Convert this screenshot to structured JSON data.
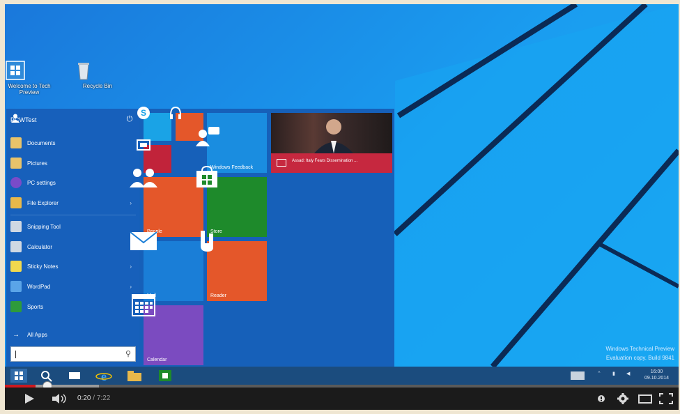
{
  "desktop": {
    "icons": [
      {
        "label": "Welcome to Tech Preview"
      },
      {
        "label": "Recycle Bin"
      }
    ],
    "watermark_line1": "Windows Technical Preview",
    "watermark_line2": "Evaluation copy. Build 9841"
  },
  "start_menu": {
    "user_name": "PCWTest",
    "places": [
      {
        "label": "Documents",
        "icon": "documents-icon",
        "color": "#e8c36a"
      },
      {
        "label": "Pictures",
        "icon": "pictures-icon",
        "color": "#e8c36a"
      },
      {
        "label": "PC settings",
        "icon": "gear-icon",
        "color": "#7a4bc9"
      },
      {
        "label": "File Explorer",
        "icon": "folder-icon",
        "color": "#e8b84a"
      }
    ],
    "apps": [
      {
        "label": "Snipping Tool",
        "icon": "scissors-icon",
        "color": "#cfd8e3"
      },
      {
        "label": "Calculator",
        "icon": "calculator-icon",
        "color": "#cfd8e3"
      },
      {
        "label": "Sticky Notes",
        "icon": "sticky-notes-icon",
        "color": "#f1d94e"
      },
      {
        "label": "WordPad",
        "icon": "wordpad-icon",
        "color": "#5aa4e8"
      },
      {
        "label": "Sports",
        "icon": "sports-icon",
        "color": "#2e9b3b"
      }
    ],
    "all_apps": "All Apps",
    "search_placeholder": "",
    "tiles": {
      "skype": {
        "label": "",
        "color": "#1aa3e6"
      },
      "music": {
        "label": "",
        "color": "#e4572a"
      },
      "video": {
        "label": "",
        "color": "#c1233a"
      },
      "feedback": {
        "label": "Windows Feedback",
        "color": "#1a8de0"
      },
      "news": {
        "label": "Assad: Italy Fears Dissemination ..."
      },
      "people": {
        "label": "People",
        "color": "#e4572a"
      },
      "store": {
        "label": "Store",
        "color": "#1e8a2b"
      },
      "mail": {
        "label": "Mail",
        "color": "#1a7ed7"
      },
      "reader": {
        "label": "Reader",
        "color": "#e4572a"
      },
      "calendar": {
        "label": "Calendar",
        "color": "#7b4bc0"
      }
    }
  },
  "taskbar": {
    "clock_time": "16:00",
    "clock_date": "09.10.2014"
  },
  "player": {
    "current_time": "0:20",
    "duration": "7:22",
    "progress_fraction": 0.045,
    "buffered_fraction": 0.14,
    "icons": [
      "play-icon",
      "volume-icon",
      "annotations-icon",
      "settings-icon",
      "theater-icon",
      "fullscreen-icon"
    ]
  }
}
